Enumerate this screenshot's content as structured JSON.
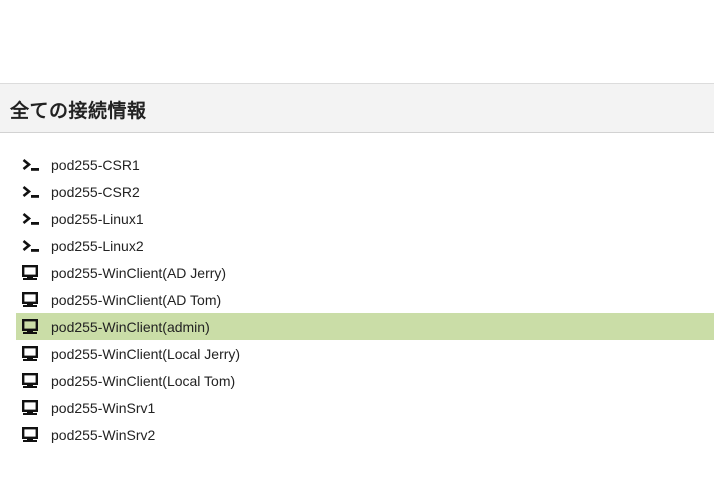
{
  "section": {
    "title": "全ての接続情報"
  },
  "connections": [
    {
      "name": "pod255-CSR1",
      "icon": "terminal-icon",
      "selected": false
    },
    {
      "name": "pod255-CSR2",
      "icon": "terminal-icon",
      "selected": false
    },
    {
      "name": "pod255-Linux1",
      "icon": "terminal-icon",
      "selected": false
    },
    {
      "name": "pod255-Linux2",
      "icon": "terminal-icon",
      "selected": false
    },
    {
      "name": "pod255-WinClient(AD Jerry)",
      "icon": "desktop-icon",
      "selected": false
    },
    {
      "name": "pod255-WinClient(AD Tom)",
      "icon": "desktop-icon",
      "selected": false
    },
    {
      "name": "pod255-WinClient(admin)",
      "icon": "desktop-icon",
      "selected": true
    },
    {
      "name": "pod255-WinClient(Local Jerry)",
      "icon": "desktop-icon",
      "selected": false
    },
    {
      "name": "pod255-WinClient(Local Tom)",
      "icon": "desktop-icon",
      "selected": false
    },
    {
      "name": "pod255-WinSrv1",
      "icon": "desktop-icon",
      "selected": false
    },
    {
      "name": "pod255-WinSrv2",
      "icon": "desktop-icon",
      "selected": false
    }
  ],
  "colors": {
    "selected_row": "#cadda7",
    "header_background": "#f3f3f3",
    "text": "#222222"
  }
}
